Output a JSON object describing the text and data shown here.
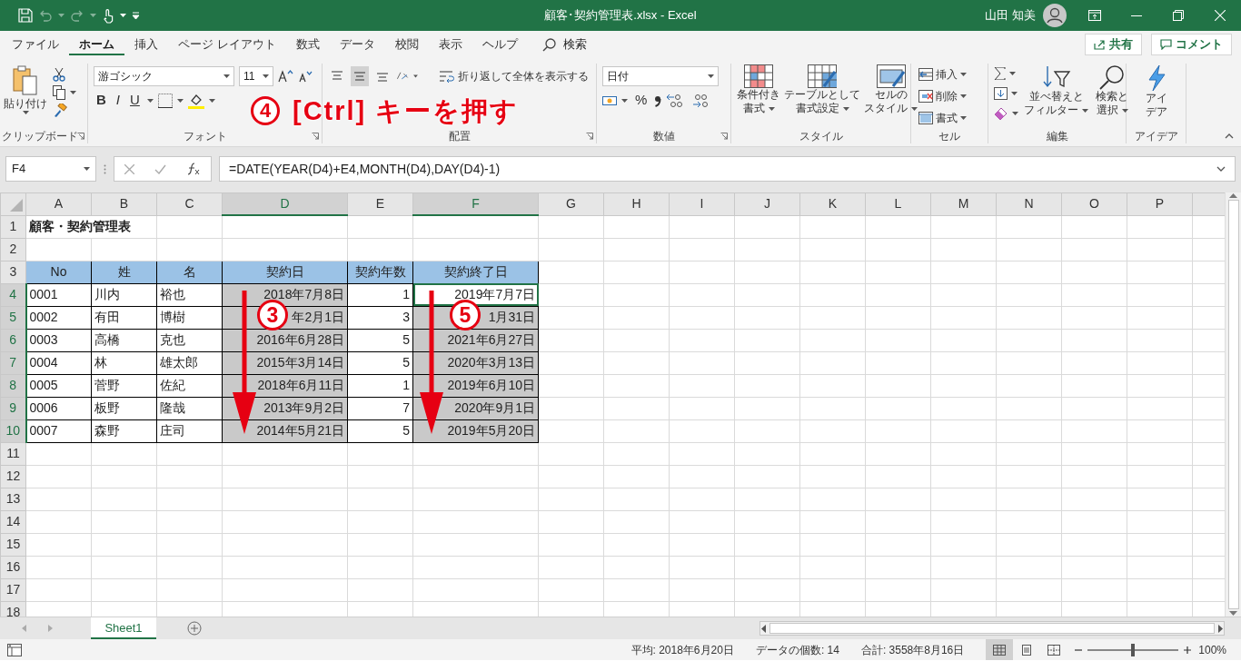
{
  "window": {
    "title": "顧客･契約管理表.xlsx - Excel",
    "user": "山田 知美"
  },
  "quick_access": {
    "undo": {
      "disabled": true
    },
    "redo": {
      "disabled": true
    }
  },
  "menu_tabs": [
    {
      "label": "ファイル",
      "selected": false
    },
    {
      "label": "ホーム",
      "selected": true
    },
    {
      "label": "挿入",
      "selected": false
    },
    {
      "label": "ページ レイアウト",
      "selected": false
    },
    {
      "label": "数式",
      "selected": false
    },
    {
      "label": "データ",
      "selected": false
    },
    {
      "label": "校閲",
      "selected": false
    },
    {
      "label": "表示",
      "selected": false
    },
    {
      "label": "ヘルプ",
      "selected": false
    }
  ],
  "search": {
    "label": "検索"
  },
  "share_button": "共有",
  "comment_button": "コメント",
  "ribbon": {
    "clipboard": {
      "paste": "貼り付け",
      "label": "クリップボード"
    },
    "font": {
      "name": "游ゴシック",
      "size": "11",
      "bold": "B",
      "italic": "I",
      "underline": "U",
      "label": "フォント"
    },
    "alignment": {
      "vertical": [
        {
          "selected": false
        },
        {
          "selected": true
        },
        {
          "selected": false
        }
      ],
      "wrap_text": "折り返して全体を表示する",
      "label": "配置"
    },
    "number": {
      "format": "日付",
      "percent": "%",
      "label": "数値"
    },
    "styles": {
      "buttons": [
        {
          "lines": [
            "条件付き",
            "書式"
          ],
          "dropdown": true
        },
        {
          "lines": [
            "テーブルとして",
            "書式設定"
          ],
          "dropdown": true
        },
        {
          "lines": [
            "セルの",
            "スタイル"
          ],
          "dropdown": true
        }
      ],
      "label": "スタイル"
    },
    "cells": {
      "buttons": [
        {
          "label": "挿入",
          "dropdown": true
        },
        {
          "label": "削除",
          "dropdown": true
        },
        {
          "label": "書式",
          "dropdown": true
        }
      ],
      "label": "セル"
    },
    "editing": {
      "buttons": [
        {
          "lines": [
            "並べ替えと",
            "フィルター"
          ],
          "dropdown": true
        },
        {
          "lines": [
            "検索と",
            "選択"
          ],
          "dropdown": true
        }
      ],
      "label": "編集"
    },
    "ideas": {
      "lines": [
        "アイ",
        "デア"
      ],
      "label": "アイデア"
    }
  },
  "formula_bar": {
    "name_box": "F4",
    "formula": "=DATE(YEAR(D4)+E4,MONTH(D4),DAY(D4)-1)"
  },
  "sheet": {
    "columns": [
      {
        "label": "A",
        "selected": false
      },
      {
        "label": "B",
        "selected": false
      },
      {
        "label": "C",
        "selected": false
      },
      {
        "label": "D",
        "selected": true
      },
      {
        "label": "E",
        "selected": false
      },
      {
        "label": "F",
        "selected": true
      },
      {
        "label": "G",
        "selected": false
      },
      {
        "label": "H",
        "selected": false
      },
      {
        "label": "I",
        "selected": false
      },
      {
        "label": "J",
        "selected": false
      },
      {
        "label": "K",
        "selected": false
      },
      {
        "label": "L",
        "selected": false
      },
      {
        "label": "M",
        "selected": false
      },
      {
        "label": "N",
        "selected": false
      },
      {
        "label": "O",
        "selected": false
      },
      {
        "label": "P",
        "selected": false
      }
    ],
    "rows": [
      {
        "number": "1",
        "selected": false,
        "kind": "title",
        "cells": [
          {
            "text": "顧客・契約管理表",
            "selected": false,
            "active": false
          }
        ]
      },
      {
        "number": "2",
        "selected": false
      },
      {
        "number": "3",
        "selected": false,
        "kind": "header",
        "cells": [
          {
            "text": "No",
            "selected": false,
            "active": false
          },
          {
            "text": "姓",
            "selected": false,
            "active": false
          },
          {
            "text": "名",
            "selected": false,
            "active": false
          },
          {
            "text": "契約日",
            "selected": false,
            "active": false
          },
          {
            "text": "契約年数",
            "selected": false,
            "active": false
          },
          {
            "text": "契約終了日",
            "selected": false,
            "active": false
          }
        ]
      },
      {
        "number": "4",
        "selected": true,
        "kind": "data",
        "cells": [
          {
            "text": "0001",
            "selected": false,
            "active": false
          },
          {
            "text": "川内",
            "selected": false,
            "active": false
          },
          {
            "text": "裕也",
            "selected": false,
            "active": false
          },
          {
            "text": "2018年7月8日",
            "selected": true,
            "active": false
          },
          {
            "text": "1",
            "selected": false,
            "active": false
          },
          {
            "text": "2019年7月7日",
            "selected": true,
            "active": true
          }
        ]
      },
      {
        "number": "5",
        "selected": true,
        "kind": "data",
        "cells": [
          {
            "text": "0002",
            "selected": false,
            "active": false
          },
          {
            "text": "有田",
            "selected": false,
            "active": false
          },
          {
            "text": "博樹",
            "selected": false,
            "active": false
          },
          {
            "text": "年2月1日",
            "selected": true,
            "active": false
          },
          {
            "text": "3",
            "selected": false,
            "active": false
          },
          {
            "text": "1月31日",
            "selected": true,
            "active": false
          }
        ]
      },
      {
        "number": "6",
        "selected": true,
        "kind": "data",
        "cells": [
          {
            "text": "0003",
            "selected": false,
            "active": false
          },
          {
            "text": "高橋",
            "selected": false,
            "active": false
          },
          {
            "text": "克也",
            "selected": false,
            "active": false
          },
          {
            "text": "2016年6月28日",
            "selected": true,
            "active": false
          },
          {
            "text": "5",
            "selected": false,
            "active": false
          },
          {
            "text": "2021年6月27日",
            "selected": true,
            "active": false
          }
        ]
      },
      {
        "number": "7",
        "selected": true,
        "kind": "data",
        "cells": [
          {
            "text": "0004",
            "selected": false,
            "active": false
          },
          {
            "text": "林",
            "selected": false,
            "active": false
          },
          {
            "text": "雄太郎",
            "selected": false,
            "active": false
          },
          {
            "text": "2015年3月14日",
            "selected": true,
            "active": false
          },
          {
            "text": "5",
            "selected": false,
            "active": false
          },
          {
            "text": "2020年3月13日",
            "selected": true,
            "active": false
          }
        ]
      },
      {
        "number": "8",
        "selected": true,
        "kind": "data",
        "cells": [
          {
            "text": "0005",
            "selected": false,
            "active": false
          },
          {
            "text": "菅野",
            "selected": false,
            "active": false
          },
          {
            "text": "佐紀",
            "selected": false,
            "active": false
          },
          {
            "text": "2018年6月11日",
            "selected": true,
            "active": false
          },
          {
            "text": "1",
            "selected": false,
            "active": false
          },
          {
            "text": "2019年6月10日",
            "selected": true,
            "active": false
          }
        ]
      },
      {
        "number": "9",
        "selected": true,
        "kind": "data",
        "cells": [
          {
            "text": "0006",
            "selected": false,
            "active": false
          },
          {
            "text": "板野",
            "selected": false,
            "active": false
          },
          {
            "text": "隆哉",
            "selected": false,
            "active": false
          },
          {
            "text": "2013年9月2日",
            "selected": true,
            "active": false
          },
          {
            "text": "7",
            "selected": false,
            "active": false
          },
          {
            "text": "2020年9月1日",
            "selected": true,
            "active": false
          }
        ]
      },
      {
        "number": "10",
        "selected": true,
        "kind": "data",
        "cells": [
          {
            "text": "0007",
            "selected": false,
            "active": false
          },
          {
            "text": "森野",
            "selected": false,
            "active": false
          },
          {
            "text": "庄司",
            "selected": false,
            "active": false
          },
          {
            "text": "2014年5月21日",
            "selected": true,
            "active": false
          },
          {
            "text": "5",
            "selected": false,
            "active": false
          },
          {
            "text": "2019年5月20日",
            "selected": true,
            "active": false
          }
        ]
      },
      {
        "number": "11",
        "selected": false
      },
      {
        "number": "12",
        "selected": false
      },
      {
        "number": "13",
        "selected": false
      },
      {
        "number": "14",
        "selected": false
      },
      {
        "number": "15",
        "selected": false
      },
      {
        "number": "16",
        "selected": false
      },
      {
        "number": "17",
        "selected": false
      },
      {
        "number": "18",
        "selected": false
      }
    ]
  },
  "annotations": {
    "callout": {
      "number": "4",
      "text": "[Ctrl] キーを押す"
    },
    "markers": [
      {
        "number": "3"
      },
      {
        "number": "5"
      }
    ]
  },
  "sheet_tabs": [
    {
      "label": "Sheet1",
      "selected": true
    }
  ],
  "status_bar": {
    "average": "平均: 2018年6月20日",
    "count": "データの個数: 14",
    "sum": "合計: 3558年8月16日",
    "views": [
      {
        "selected": true
      },
      {
        "selected": false
      },
      {
        "selected": false
      }
    ],
    "zoom": {
      "level": 0.5,
      "reading": "100%"
    }
  }
}
